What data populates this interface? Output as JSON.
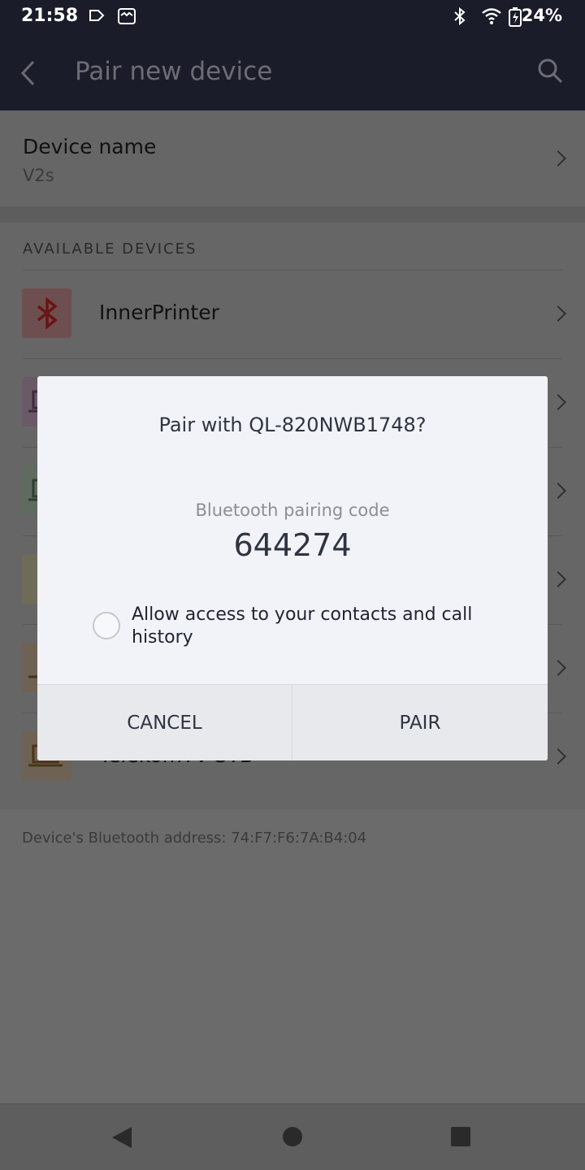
{
  "status_bar": {
    "time": "21:58",
    "battery": "24%"
  },
  "app_bar": {
    "title": "Pair new device"
  },
  "device_name": {
    "label": "Device name",
    "value": "V2s"
  },
  "available_devices": {
    "header": "AVAILABLE DEVICES",
    "items": [
      {
        "name": "InnerPrinter",
        "icon": "bluetooth-icon"
      },
      {
        "name": "",
        "icon": "laptop-icon"
      },
      {
        "name": "",
        "icon": "laptop-icon"
      },
      {
        "name": "",
        "icon": "device-icon"
      },
      {
        "name": "",
        "icon": "laptop-icon"
      },
      {
        "name": "TelekomTV-STB",
        "icon": "laptop-icon"
      }
    ]
  },
  "footer": {
    "bt_address": "Device's Bluetooth address: 74:F7:F6:7A:B4:04"
  },
  "dialog": {
    "title": "Pair with QL-820NWB1748?",
    "code_label": "Bluetooth pairing code",
    "code": "644274",
    "allow_access_label": "Allow access to your contacts and call history",
    "cancel_label": "CANCEL",
    "pair_label": "PAIR"
  }
}
